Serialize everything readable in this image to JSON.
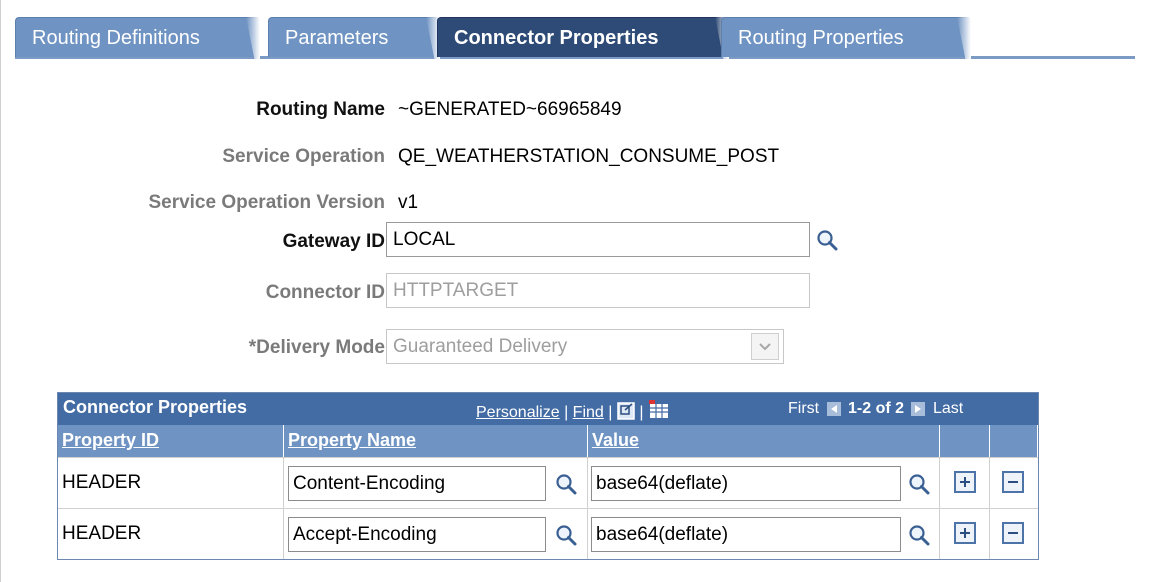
{
  "tabs": [
    {
      "label": "Routing Definitions"
    },
    {
      "label": "Parameters"
    },
    {
      "label": "Connector Properties"
    },
    {
      "label": "Routing Properties"
    }
  ],
  "form": {
    "routing_name_label": "Routing Name",
    "routing_name_value": "~GENERATED~66965849",
    "service_operation_label": "Service Operation",
    "service_operation_value": "QE_WEATHERSTATION_CONSUME_POST",
    "service_operation_version_label": "Service Operation Version",
    "service_operation_version_value": "v1",
    "gateway_id_label": "Gateway ID",
    "gateway_id_value": "LOCAL",
    "connector_id_label": "Connector ID",
    "connector_id_value": "HTTPTARGET",
    "delivery_mode_label": "*Delivery Mode",
    "delivery_mode_value": "Guaranteed Delivery"
  },
  "grid": {
    "title": "Connector Properties",
    "personalize": "Personalize",
    "sep": "|",
    "find": "Find",
    "first": "First",
    "range": "1-2 of 2",
    "last": "Last",
    "columns": [
      "Property ID",
      "Property Name",
      "Value"
    ],
    "rows": [
      {
        "property_id": "HEADER",
        "property_name": "Content-Encoding",
        "value": "base64(deflate)"
      },
      {
        "property_id": "HEADER",
        "property_name": "Accept-Encoding",
        "value": "base64(deflate)"
      }
    ]
  },
  "icons": {
    "lookup": "magnifier-icon",
    "add": "plus-icon",
    "delete": "minus-icon"
  },
  "colors": {
    "tab_inactive": "#6f93c2",
    "tab_active": "#2e4a76",
    "grid_header": "#436ca4"
  }
}
